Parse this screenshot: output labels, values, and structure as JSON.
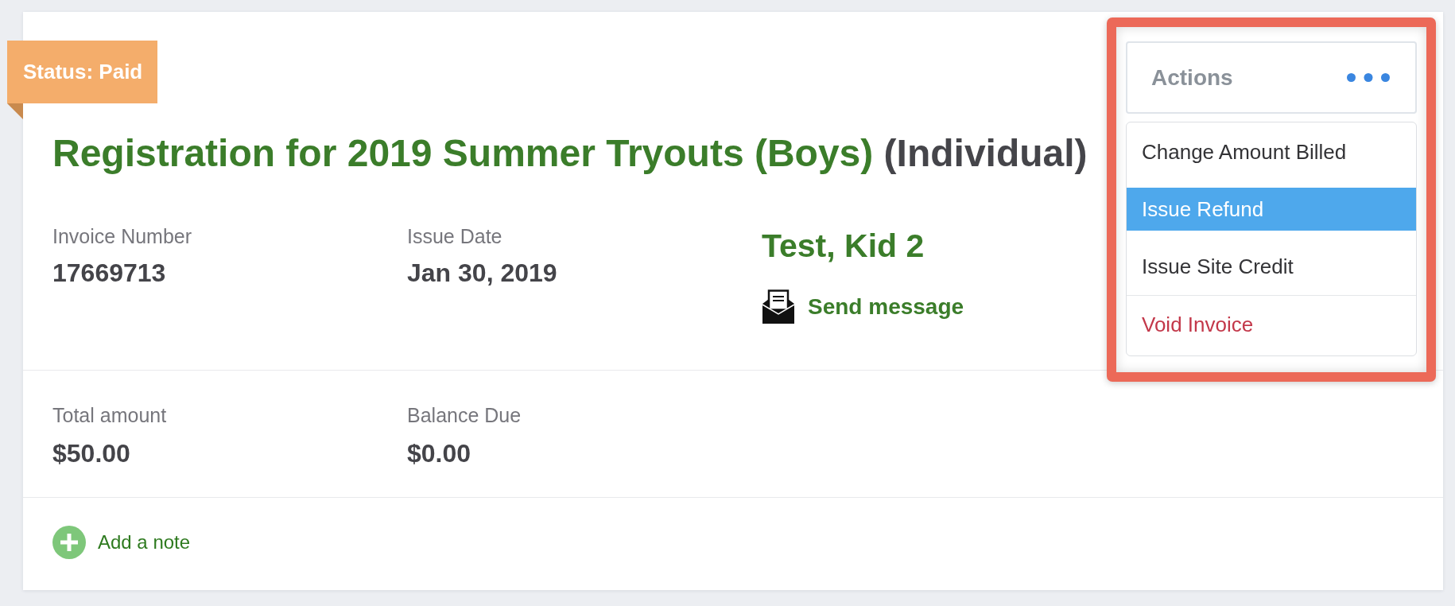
{
  "status_badge": {
    "label": "Status: Paid"
  },
  "title": {
    "text": "Registration for 2019 Summer Tryouts (Boys)",
    "suffix": "(Individual)"
  },
  "details": [
    {
      "label": "Invoice Number",
      "value": "17669713"
    },
    {
      "label": "Issue Date",
      "value": "Jan 30, 2019"
    }
  ],
  "recipient": {
    "name": "Test, Kid 2",
    "action": "Send message"
  },
  "totals": [
    {
      "label": "Total amount",
      "value": "$50.00"
    },
    {
      "label": "Balance Due",
      "value": "$0.00"
    }
  ],
  "note_action": {
    "label": "Add a note"
  },
  "actions_menu": {
    "title": "Actions",
    "items": [
      {
        "label": "Change Amount Billed",
        "kind": "normal",
        "selected": false
      },
      {
        "label": "Issue Refund",
        "kind": "normal",
        "selected": true
      },
      {
        "label": "Issue Site Credit",
        "kind": "normal",
        "selected": false
      },
      {
        "label": "Void Invoice",
        "kind": "danger",
        "selected": false
      }
    ]
  }
}
